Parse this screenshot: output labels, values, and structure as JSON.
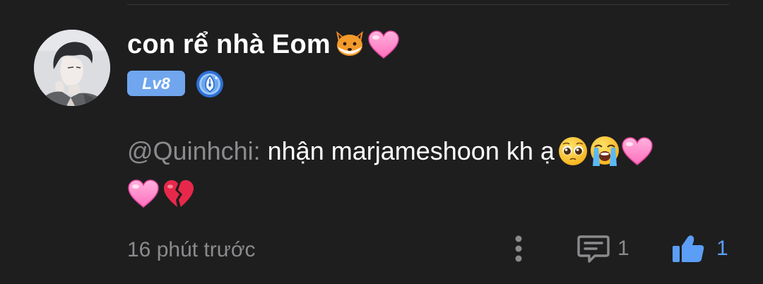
{
  "comment": {
    "username": "con rể nhà Eom",
    "username_emojis": [
      "fox-emoji",
      "pink-heart-emoji"
    ],
    "level": "Lv8",
    "badge_icon": "fountain-pen-badge-icon",
    "mention": "@Quinhchi:",
    "text_line1": "nhận marjameshoon kh ạ",
    "line1_emojis": [
      "pleading-face-emoji",
      "crying-face-emoji",
      "pink-heart-emoji"
    ],
    "line2_emojis": [
      "pink-heart-emoji",
      "broken-heart-emoji"
    ],
    "timestamp": "16 phút trước"
  },
  "actions": {
    "more_icon": "vertical-dots-icon",
    "reply_icon": "comment-bubble-icon",
    "reply_count": "1",
    "like_icon": "thumbs-up-icon",
    "like_count": "1"
  },
  "colors": {
    "background": "#1e1e1f",
    "text_primary": "#ffffff",
    "text_secondary": "#8b8b8e",
    "level_badge": "#6fa6ee",
    "like_active": "#5b9ef5"
  }
}
